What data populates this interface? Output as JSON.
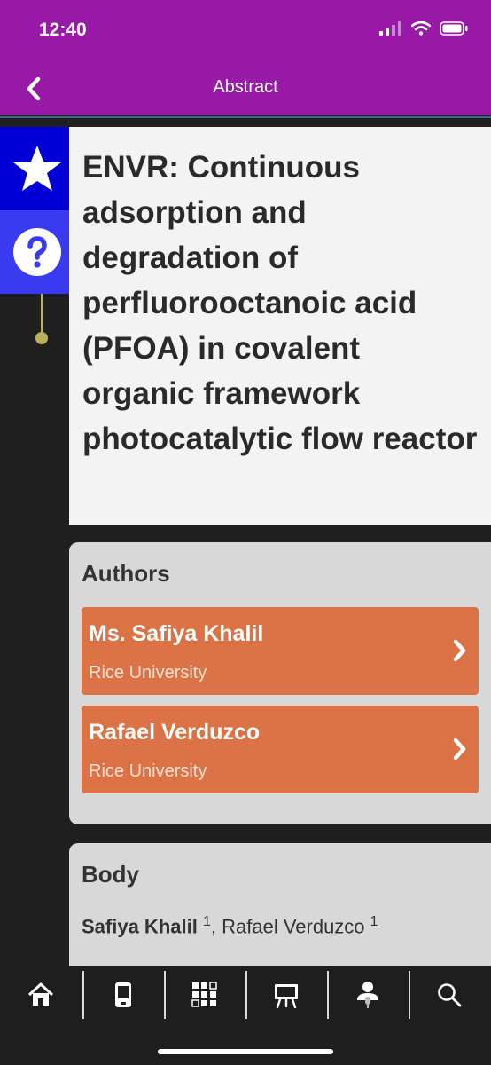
{
  "status": {
    "time": "12:40"
  },
  "nav": {
    "title": "Abstract"
  },
  "abstract": {
    "title": "ENVR: Continuous adsorption and degradation of perfluorooctanoic acid (PFOA) in covalent organic framework photocatalytic flow reactor"
  },
  "authors": {
    "heading": "Authors",
    "items": [
      {
        "name": "Ms. Safiya Khalil",
        "affiliation": "Rice University"
      },
      {
        "name": "Rafael Verduzco",
        "affiliation": "Rice University"
      }
    ]
  },
  "body": {
    "heading": "Body",
    "author1": "Safiya Khalil",
    "sup1": "1",
    "sep": ", ",
    "author2": "Rafael Verduzco",
    "sup2": "1"
  },
  "tabs": [
    "home-icon",
    "mobile-icon",
    "grid-icon",
    "presentation-icon",
    "speaker-icon",
    "search-icon"
  ],
  "colors": {
    "header": "#9a1aa8",
    "star": "#0000d6",
    "help": "#3a3af0",
    "author": "#db7346",
    "card": "#d8d8d8"
  }
}
